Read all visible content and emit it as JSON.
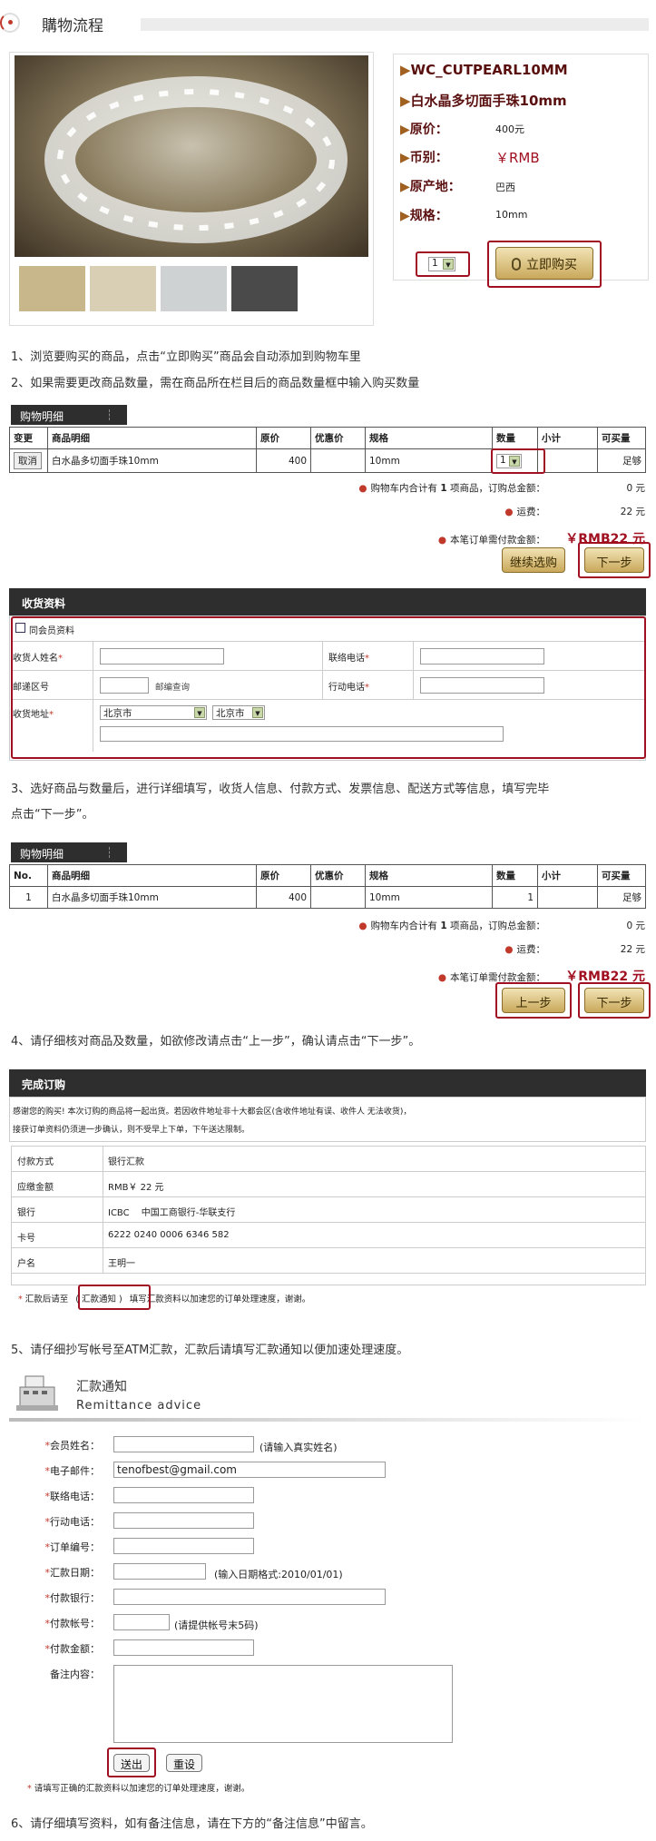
{
  "header": {
    "title": "購物流程"
  },
  "product": {
    "code": "WC_CUTPEARL10MM",
    "name": "白水晶多切面手珠10mm",
    "price_label": "原价",
    "price": "400元",
    "currency_label": "币别",
    "currency": "￥RMB",
    "origin_label": "原产地",
    "origin": "巴西",
    "size_label": "规格",
    "size": "10mm",
    "qty": "1",
    "buy_label": "立即购买"
  },
  "steps": {
    "s1": "1、浏览要购买的商品，点击“立即购买”商品会自动添加到购物车里",
    "s2": "2、如果需要更改商品数量，需在商品所在栏目后的商品数量框中输入购买数量",
    "s3a": "3、选好商品与数量后，进行详细填写，收货人信息、付款方式、发票信息、配送方式等信息，填写完毕",
    "s3b": "点击“下一步”。",
    "s4": "4、请仔细核对商品及数量，如欲修改请点击“上一步”，确认请点击“下一步”。",
    "s5": "5、请仔细抄写帐号至ATM汇款，汇款后请填写汇款通知以便加速处理速度。",
    "s6": "6、请仔细填写资料，如有备注信息，请在下方的“备注信息”中留言。"
  },
  "cart1": {
    "tab": "购物明细",
    "headers": [
      "变更",
      "商品明细",
      "原价",
      "优惠价",
      "规格",
      "数量",
      "小计",
      "可买量"
    ],
    "cancel": "取消",
    "item": "白水晶多切面手珠10mm",
    "price": "400",
    "spec": "10mm",
    "qty": "1",
    "stock": "足够",
    "sum1_label": "购物车内合计有",
    "sum1_count": "1",
    "sum1_mid": "项商品，订购总金额：",
    "sum1_val": "0 元",
    "ship_label": "运费：",
    "ship_val": "22 元",
    "total_label": "本笔订单需付款金额：",
    "total_val": "￥RMB22 元",
    "continue": "继续选购",
    "next": "下一步"
  },
  "recv": {
    "title": "收货资料",
    "same": "同会员资料",
    "name": "收货人姓名",
    "phone": "联络电话",
    "zip": "邮递区号",
    "zip_q": "邮编查询",
    "mobile": "行动电话",
    "addr": "收货地址",
    "city1": "北京市",
    "city2": "北京市"
  },
  "cart2": {
    "tab": "购物明细",
    "headers": [
      "No.",
      "商品明细",
      "原价",
      "优惠价",
      "规格",
      "数量",
      "小计",
      "可买量"
    ],
    "no": "1",
    "item": "白水晶多切面手珠10mm",
    "price": "400",
    "spec": "10mm",
    "qty": "1",
    "stock": "足够",
    "prev": "上一步",
    "next": "下一步"
  },
  "done": {
    "title": "完成订购",
    "msg1": "感谢您的购买! 本次订购的商品将一起出货。若因收件地址非十大都会区(含收件地址有误、收件人 无法收货)，",
    "msg2": "接获订单资料仍须进一步确认，则不受早上下单，下午送达限制。",
    "rows": [
      {
        "k": "付款方式",
        "v": "银行汇款"
      },
      {
        "k": "应缴金额",
        "v": "RMB￥ 22 元"
      },
      {
        "k": "银行",
        "v": "ICBC　 中国工商银行-华联支行"
      },
      {
        "k": "卡号",
        "v": "6222 0240 0006 6346 582"
      },
      {
        "k": "户名",
        "v": "王明一"
      }
    ],
    "note_a": "汇款后请至",
    "note_link": "( 汇款通知 )",
    "note_b": "填写汇款资料以加速您的订单处理速度，谢谢。"
  },
  "remit": {
    "title": "汇款通知",
    "subtitle": "Remittance advice",
    "fields": [
      "会员姓名：",
      "电子邮件：",
      "联络电话：",
      "行动电话：",
      "订单编号：",
      "汇款日期：",
      "付款银行：",
      "付款帐号：",
      "付款金额："
    ],
    "name_hint": "(请输入真实姓名)",
    "email": "tenofbest@gmail.com",
    "date_hint": "(输入日期格式:2010/01/01)",
    "acct_hint": "(请提供帐号末5码)",
    "memo": "备注内容：",
    "submit": "送出",
    "reset": "重设",
    "footnote": "请填写正确的汇款资料以加速您的订单处理速度，谢谢。"
  }
}
